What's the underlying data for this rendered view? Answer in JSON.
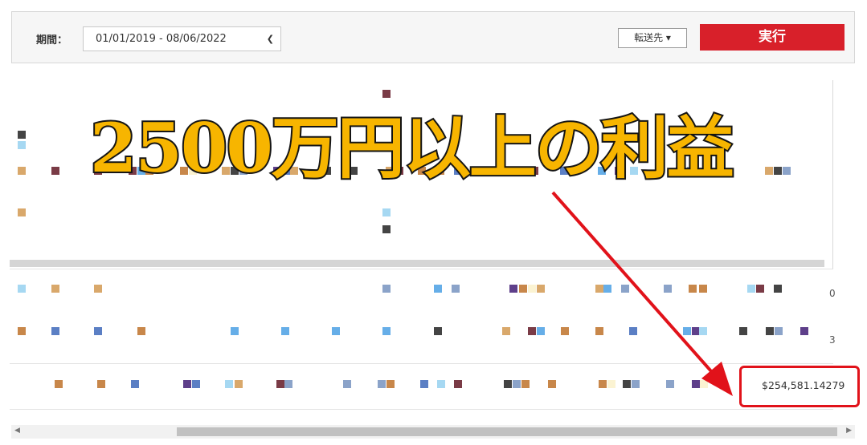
{
  "filter": {
    "period_label": "期間：",
    "date_range": "01/01/2019 - 08/06/2022",
    "transfer_label": "転送先",
    "run_label": "実行"
  },
  "overlay": {
    "headline": "2500万円以上の利益"
  },
  "table": {
    "row_edge_values": [
      "0",
      "3"
    ],
    "total_value": "$254,581.14279"
  },
  "colors": {
    "run_button": "#d8202a",
    "highlight": "#e1121a",
    "headline_fill": "#f7b500"
  }
}
